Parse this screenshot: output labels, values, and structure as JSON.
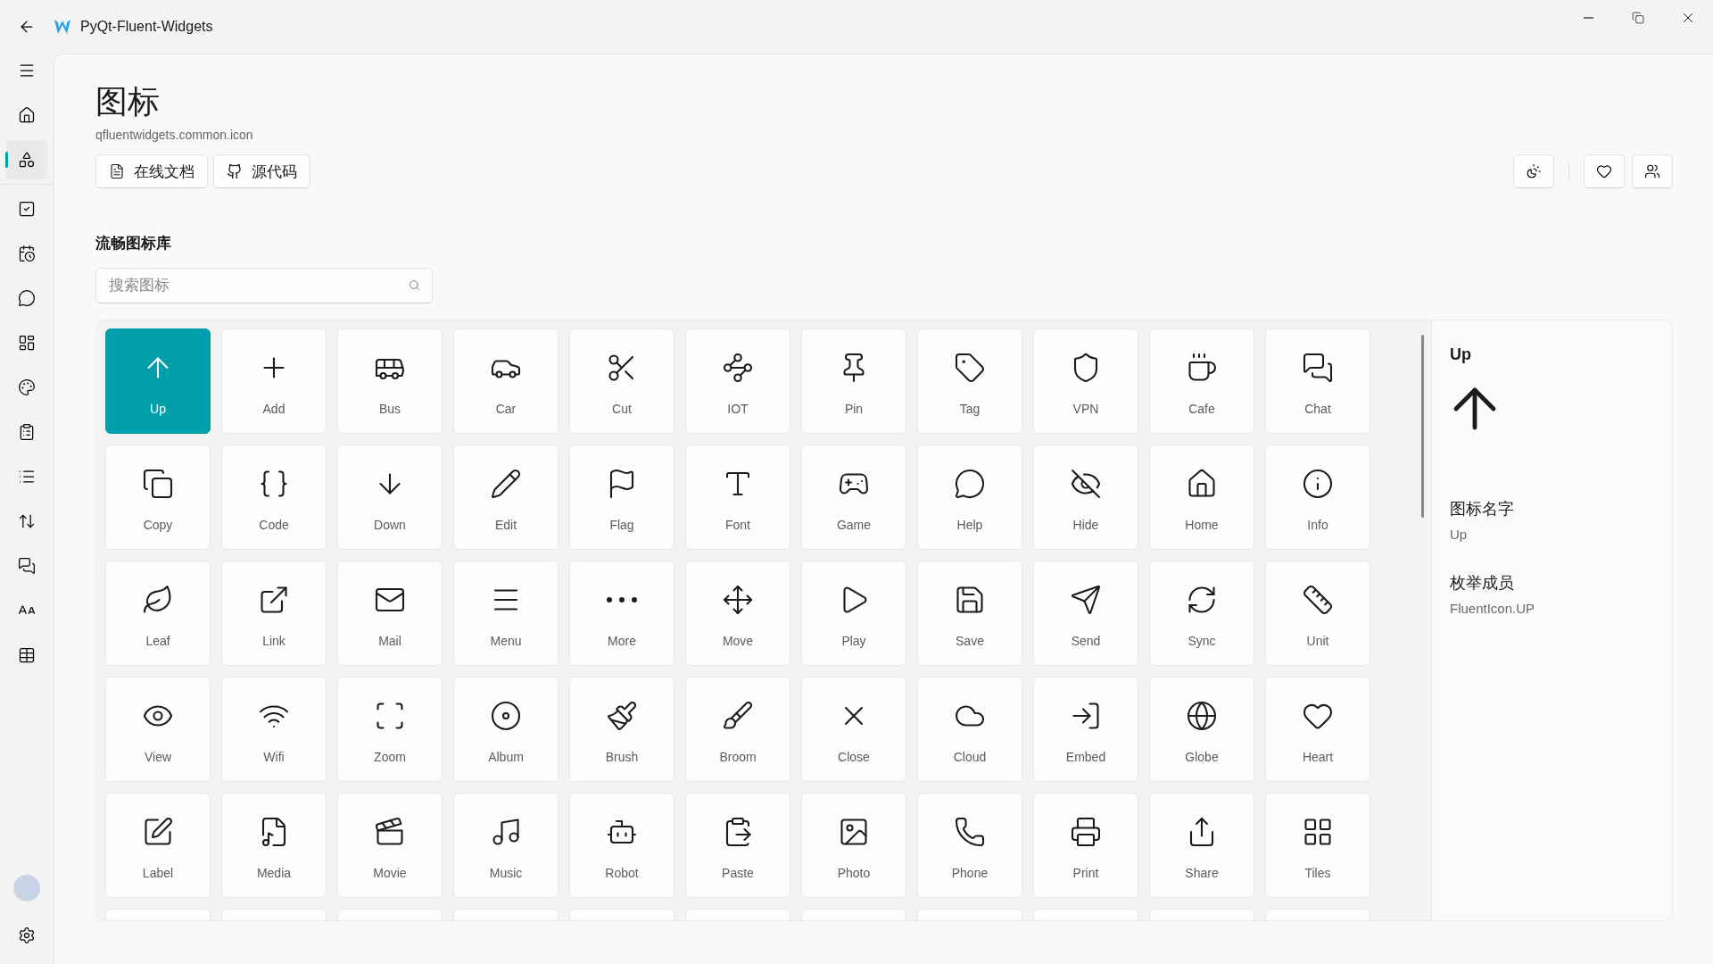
{
  "window": {
    "title": "PyQt-Fluent-Widgets"
  },
  "sidebar": {
    "items": [
      {
        "selected": false
      },
      {
        "selected": false
      },
      {
        "selected": true
      },
      {
        "selected": false
      },
      {
        "selected": false
      },
      {
        "selected": false
      },
      {
        "selected": false
      },
      {
        "selected": false
      },
      {
        "selected": false
      },
      {
        "selected": false
      },
      {
        "selected": false
      },
      {
        "selected": false
      },
      {
        "selected": false
      },
      {
        "selected": false
      }
    ]
  },
  "header": {
    "title": "图标",
    "subtitle": "qfluentwidgets.common.icon",
    "buttons": [
      "在线文档",
      "源代码"
    ]
  },
  "section_title": "流畅图标库",
  "search": {
    "placeholder": "搜索图标"
  },
  "icons": [
    {
      "label": "Up",
      "selected": true
    },
    {
      "label": "Add",
      "selected": false
    },
    {
      "label": "Bus",
      "selected": false
    },
    {
      "label": "Car",
      "selected": false
    },
    {
      "label": "Cut",
      "selected": false
    },
    {
      "label": "IOT",
      "selected": false
    },
    {
      "label": "Pin",
      "selected": false
    },
    {
      "label": "Tag",
      "selected": false
    },
    {
      "label": "VPN",
      "selected": false
    },
    {
      "label": "Cafe",
      "selected": false
    },
    {
      "label": "Chat",
      "selected": false
    },
    {
      "label": "Copy",
      "selected": false
    },
    {
      "label": "Code",
      "selected": false
    },
    {
      "label": "Down",
      "selected": false
    },
    {
      "label": "Edit",
      "selected": false
    },
    {
      "label": "Flag",
      "selected": false
    },
    {
      "label": "Font",
      "selected": false
    },
    {
      "label": "Game",
      "selected": false
    },
    {
      "label": "Help",
      "selected": false
    },
    {
      "label": "Hide",
      "selected": false
    },
    {
      "label": "Home",
      "selected": false
    },
    {
      "label": "Info",
      "selected": false
    },
    {
      "label": "Leaf",
      "selected": false
    },
    {
      "label": "Link",
      "selected": false
    },
    {
      "label": "Mail",
      "selected": false
    },
    {
      "label": "Menu",
      "selected": false
    },
    {
      "label": "More",
      "selected": false
    },
    {
      "label": "Move",
      "selected": false
    },
    {
      "label": "Play",
      "selected": false
    },
    {
      "label": "Save",
      "selected": false
    },
    {
      "label": "Send",
      "selected": false
    },
    {
      "label": "Sync",
      "selected": false
    },
    {
      "label": "Unit",
      "selected": false
    },
    {
      "label": "View",
      "selected": false
    },
    {
      "label": "Wifi",
      "selected": false
    },
    {
      "label": "Zoom",
      "selected": false
    },
    {
      "label": "Album",
      "selected": false
    },
    {
      "label": "Brush",
      "selected": false
    },
    {
      "label": "Broom",
      "selected": false
    },
    {
      "label": "Close",
      "selected": false
    },
    {
      "label": "Cloud",
      "selected": false
    },
    {
      "label": "Embed",
      "selected": false
    },
    {
      "label": "Globe",
      "selected": false
    },
    {
      "label": "Heart",
      "selected": false
    },
    {
      "label": "Label",
      "selected": false
    },
    {
      "label": "Media",
      "selected": false
    },
    {
      "label": "Movie",
      "selected": false
    },
    {
      "label": "Music",
      "selected": false
    },
    {
      "label": "Robot",
      "selected": false
    },
    {
      "label": "Paste",
      "selected": false
    },
    {
      "label": "Photo",
      "selected": false
    },
    {
      "label": "Phone",
      "selected": false
    },
    {
      "label": "Print",
      "selected": false
    },
    {
      "label": "Share",
      "selected": false
    },
    {
      "label": "Tiles",
      "selected": false
    }
  ],
  "details": {
    "title": "Up",
    "fields": [
      {
        "label": "图标名字",
        "value": "Up"
      },
      {
        "label": "枚举成员",
        "value": "FluentIcon.UP"
      }
    ]
  }
}
